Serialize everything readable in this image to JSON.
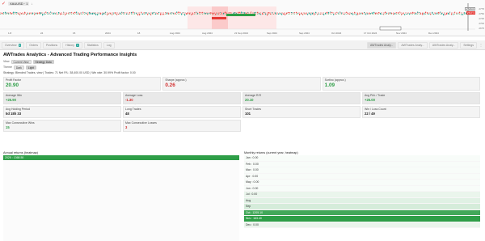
{
  "colors": {
    "accent_green": "#2e9e47",
    "accent_red": "#d32f2f",
    "tab_badge": "#26a69a"
  },
  "chart": {
    "symbol": "XAUUSD · 1",
    "timeframe": "↓",
    "date_labels": [
      "1.8",
      "24",
      "15",
      "2024",
      "18",
      "Aug 2024",
      "Aug 2024",
      "21 Sep 2024",
      "Sep 2024",
      "Sep 2024",
      "Oct 2024",
      "17 Oct 2024",
      "Nov 2024",
      "Dec 2024"
    ],
    "price_ticks": [
      "2775",
      "2750",
      "2725",
      "2700",
      "2675"
    ],
    "last_price": "2717.3",
    "ref_price": "2720.0"
  },
  "tabs": {
    "left": [
      {
        "label": "Overview",
        "count": "3"
      },
      {
        "label": "Orders",
        "count": ""
      },
      {
        "label": "Positions",
        "count": ""
      },
      {
        "label": "History",
        "count": "3"
      },
      {
        "label": "Statistics",
        "count": ""
      },
      {
        "label": "Log",
        "count": ""
      }
    ],
    "right": [
      {
        "label": "AWTrades Analy..."
      },
      {
        "label": "AWTrades Analy..."
      },
      {
        "label": "AWTrades Analy..."
      },
      {
        "label": "Settings"
      }
    ]
  },
  "panel": {
    "title": "AWTrades Analytics - Advanced Trading Performance Insights",
    "view_label": "View",
    "view_options": [
      "Current View",
      "Strategy Data"
    ],
    "theme_label": "Theme",
    "theme_options": [
      "Dark",
      "Light"
    ],
    "strategy_line": "Strategy: Blended Trades, view | Trades: 71   Net P/L: 38,400.00 USD | Win rate: 30.99%   Profit factor: 0.00",
    "top_cards": [
      {
        "label": "Profit Factor",
        "value": "20.90",
        "sub": "gross profit / gross loss"
      },
      {
        "label": "Sharpe (approx.)",
        "value": "0.26",
        "sub": "risk-adjusted return"
      },
      {
        "label": "Sortino (approx.)",
        "value": "1.09",
        "sub": "downside-adjusted return"
      }
    ],
    "mid_cards": [
      {
        "label": "Average Win",
        "value": "+26.90",
        "sub": "per winning trade"
      },
      {
        "label": "Average Loss",
        "value": "-1.30",
        "sub": "per losing trade"
      },
      {
        "label": "Average R:R",
        "value": "20.10",
        "sub": "reward to risk"
      },
      {
        "label": "Avg P&L / Trade",
        "value": "+26.00",
        "sub": "expectancy"
      }
    ],
    "stat_cards": [
      {
        "label": "Avg Holding Period",
        "value": "5d 18h 33"
      },
      {
        "label": "Long Trades",
        "value": "48"
      },
      {
        "label": "Short Trades",
        "value": "101"
      },
      {
        "label": "Win / Loss Count",
        "value": "22 / 49"
      }
    ],
    "streak_cards": [
      {
        "label": "Max Consecutive Wins",
        "value": "15"
      },
      {
        "label": "Max Consecutive Losses",
        "value": "3"
      }
    ]
  },
  "annual": {
    "title": "Annual returns (heatmap)",
    "rows": [
      {
        "label": "2025 : 1368.50",
        "level": 1
      }
    ]
  },
  "monthly": {
    "title": "Monthly returns (current year, heatmap)",
    "rows": [
      {
        "label": "Jan : 0.00",
        "level": 0
      },
      {
        "label": "Feb : 0.00",
        "level": 0
      },
      {
        "label": "Mar : 0.00",
        "level": 0
      },
      {
        "label": "Apr : 0.00",
        "level": 0
      },
      {
        "label": "May : 0.00",
        "level": 0
      },
      {
        "label": "Jun : 0.00",
        "level": 0
      },
      {
        "label": "Jul : 0.00",
        "level": 0.1
      },
      {
        "label": "Aug",
        "level": 0.15
      },
      {
        "label": "Sep",
        "level": 0.2
      },
      {
        "label": "Oct : 1205.10",
        "level": 0.9
      },
      {
        "label": "Nov : 163.40",
        "level": 1
      },
      {
        "label": "Dec : 0.00",
        "level": 0.1
      }
    ]
  }
}
